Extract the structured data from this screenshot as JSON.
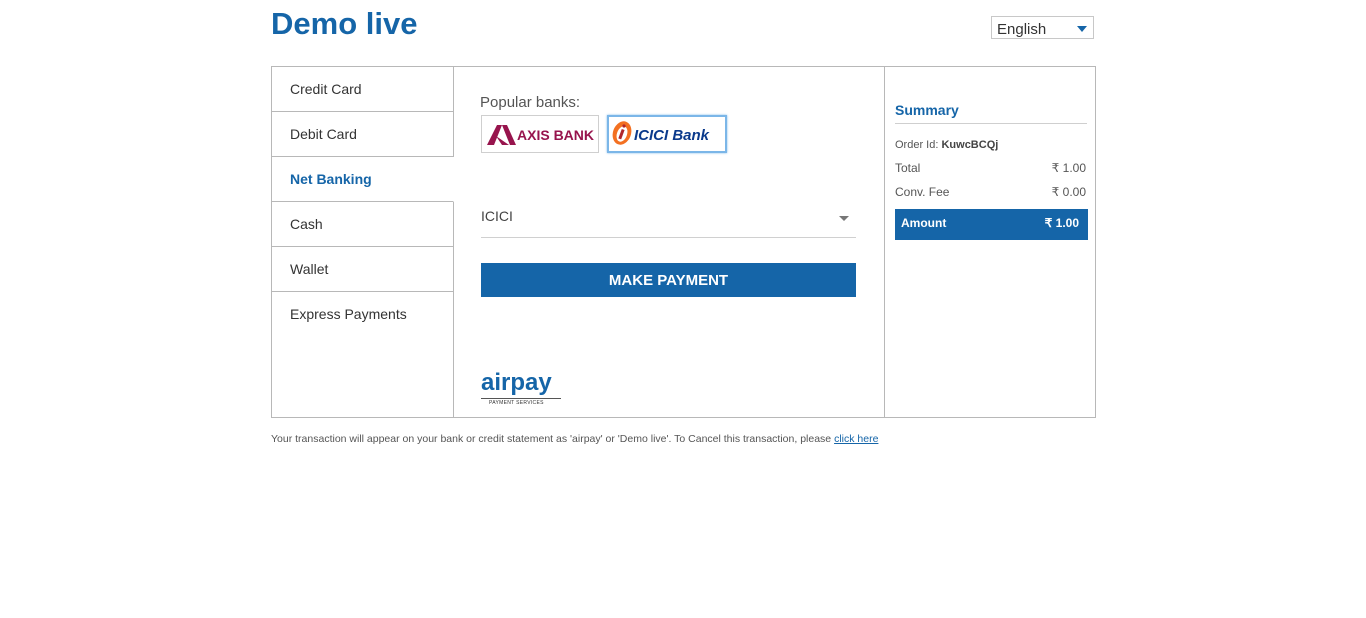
{
  "merchant": {
    "name": "Demo live"
  },
  "language": {
    "selected": "English"
  },
  "tabs": [
    {
      "label": "Credit Card"
    },
    {
      "label": "Debit Card"
    },
    {
      "label": "Net Banking"
    },
    {
      "label": "Cash"
    },
    {
      "label": "Wallet"
    },
    {
      "label": "Express Payments"
    }
  ],
  "active_tab": "Net Banking",
  "net_banking": {
    "popular_label": "Popular banks:",
    "banks": [
      {
        "name": "AXIS BANK",
        "selected": false,
        "brand_color": "#97144d"
      },
      {
        "name": "ICICI Bank",
        "selected": true,
        "brand_color": "#0b3a8c"
      }
    ],
    "selected_bank": "ICICI",
    "pay_button": "MAKE PAYMENT"
  },
  "brand": {
    "logo_text": "airpay",
    "logo_sub": "PAYMENT SERVICES",
    "color": "#1565a8"
  },
  "summary": {
    "title": "Summary",
    "order_label": "Order Id:",
    "order_id": "KuwcBCQj",
    "total_label": "Total",
    "total_value": "₹ 1.00",
    "fee_label": "Conv. Fee",
    "fee_value": "₹ 0.00",
    "amount_label": "Amount",
    "amount_value": "₹ 1.00"
  },
  "footer": {
    "text": "Your transaction will appear on your bank or credit statement as 'airpay' or 'Demo live'. To Cancel this transaction, please ",
    "link": "click here"
  }
}
